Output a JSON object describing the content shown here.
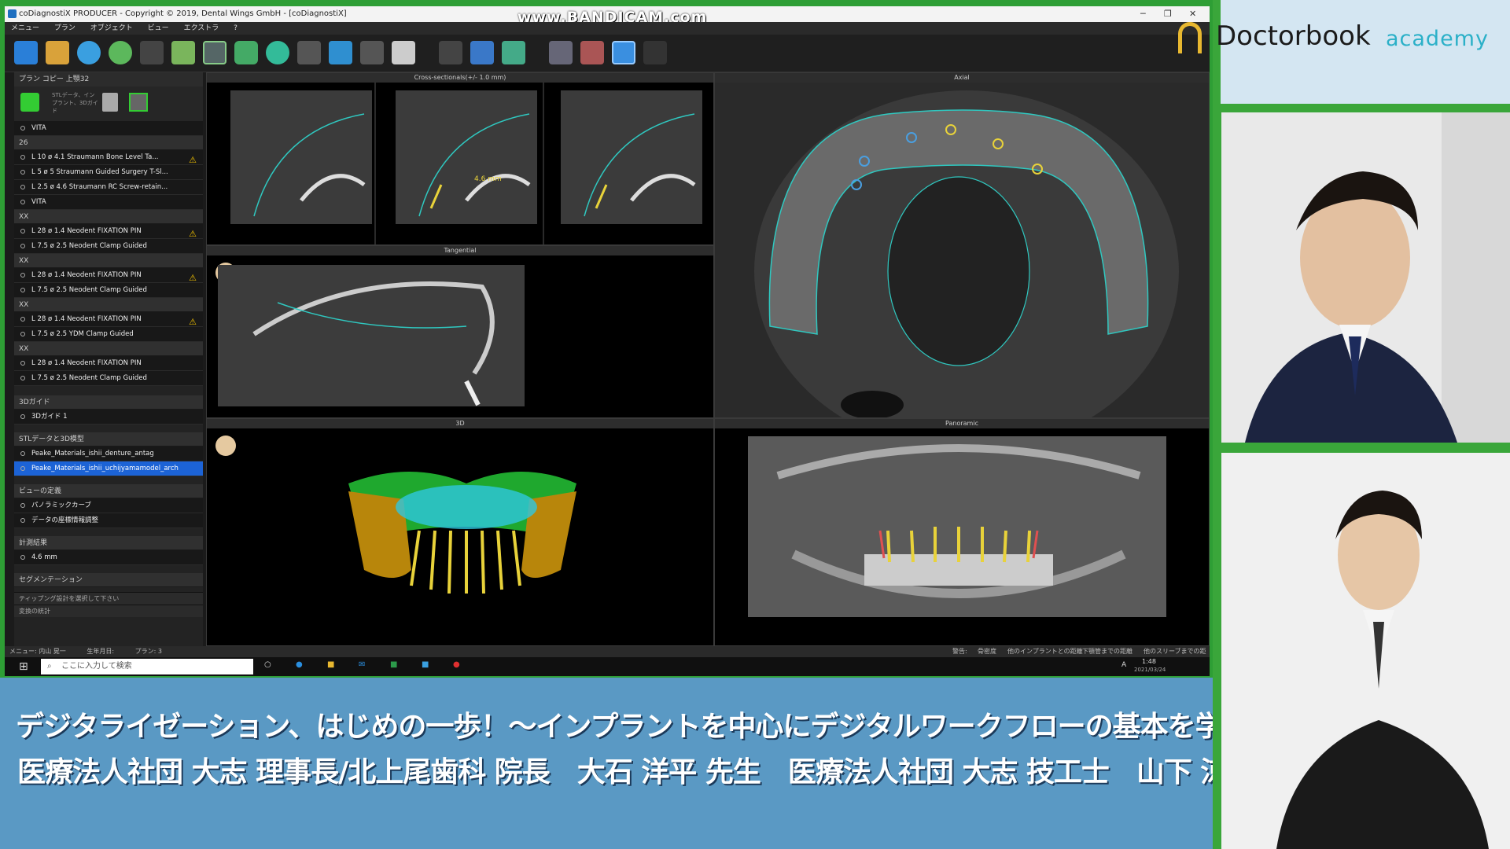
{
  "window": {
    "title": "coDiagnostiX PRODUCER - Copyright © 2019, Dental Wings GmbH - [coDiagnostiX]"
  },
  "watermark": "www.BANDICAM.com",
  "menu": [
    "メニュー",
    "プラン",
    "オブジェクト",
    "ビュー",
    "エクストラ",
    "?"
  ],
  "sidebar": {
    "header": "プラン   コピー 上顎32",
    "tools_note": "STLデータ、インプラント、3Dガイド",
    "groups": [
      {
        "name": "26",
        "items": [
          {
            "label": "L 10 ø 4.1  Straumann Bone Level Ta...",
            "warn": true
          },
          {
            "label": "L 5  ø 5  Straumann Guided Surgery T-Sl...",
            "warn": false
          },
          {
            "label": "L 2.5 ø 4.6  Straumann RC Screw-retain...",
            "warn": false
          },
          {
            "label": "VITA",
            "warn": false
          }
        ]
      },
      {
        "name": "XX",
        "items": [
          {
            "label": "L 28 ø 1.4  Neodent FIXATION PIN",
            "warn": true
          },
          {
            "label": "L 7.5 ø 2.5  Neodent Clamp Guided",
            "warn": false
          }
        ]
      },
      {
        "name": "XX",
        "items": [
          {
            "label": "L 28 ø 1.4  Neodent FIXATION PIN",
            "warn": true
          },
          {
            "label": "L 7.5 ø 2.5  Neodent Clamp Guided",
            "warn": false
          }
        ]
      },
      {
        "name": "XX",
        "items": [
          {
            "label": "L 28 ø 1.4  Neodent FIXATION PIN",
            "warn": true
          },
          {
            "label": "L 7.5 ø 2.5  YDM Clamp Guided",
            "warn": false
          }
        ]
      },
      {
        "name": "XX",
        "items": [
          {
            "label": "L 28 ø 1.4  Neodent FIXATION PIN",
            "warn": false
          },
          {
            "label": "L 7.5 ø 2.5  Neodent Clamp Guided",
            "warn": false
          }
        ]
      }
    ],
    "top_item": "VITA",
    "guide_group": "3Dガイド",
    "guide_item": "3Dガイド 1",
    "stl_group": "STLデータと3D模型",
    "stl_items": [
      "Peake_Materials_ishii_denture_antag",
      "Peake_Materials_ishii_uchijyamamodel_arch"
    ],
    "view_group": "ビューの定義",
    "view_items": [
      "パノラミックカーブ",
      "データの座標情報調整"
    ],
    "measure_group": "計測結果",
    "measure_items": [
      "4.6 mm"
    ],
    "seg_group": "セグメンテーション",
    "bottom1": "ティップング設計を選択して下さい",
    "bottom2": "変換の統計"
  },
  "viewports": {
    "cross": "Cross-sectionals(+/- 1.0 mm)",
    "axial": "Axial",
    "tangential": "Tangential",
    "three_d": "3D",
    "panoramic": "Panoramic",
    "cross_measure": "4.6 mm"
  },
  "statusbar": {
    "left": [
      "メニュー: 内山 晃一",
      "生年月日:",
      "プラン: 3"
    ],
    "right": [
      "警告:",
      "骨密度",
      "他のインプラントとの距離",
      "下顎管までの距離",
      "他のスリーブまでの距離"
    ]
  },
  "taskbar": {
    "search_placeholder": "ここに入力して検索",
    "time": "1:48",
    "date": "2021/03/24",
    "ime": "A"
  },
  "caption": {
    "line1": "デジタライゼーション、はじめの一歩！～インプラントを中心にデジタルワークフローの基本を学ぶ～",
    "line2": "医療法人社団 大志 理事長/北上尾歯科 院長　大石 洋平 先生　医療法人社団 大志 技工士　山下 涼平 先生"
  },
  "logo": {
    "name": "Doctorbook",
    "sub": "academy"
  },
  "colors": {
    "frame_green": "#2e9e35",
    "caption_blue": "#5a99c4",
    "selected_blue": "#1c63d6",
    "warn_yellow": "#f2c200",
    "accent_cyan": "#2bb0c8"
  },
  "icons": [
    "back-icon",
    "folder-icon",
    "refresh-icon",
    "globe-icon",
    "implant-icon",
    "guide-icon",
    "measure-icon",
    "add-icon",
    "trash-icon",
    "check-icon",
    "head-icon",
    "windows-icon",
    "search-icon",
    "edge-icon",
    "explorer-icon",
    "mail-icon",
    "excel-icon",
    "record-icon"
  ]
}
